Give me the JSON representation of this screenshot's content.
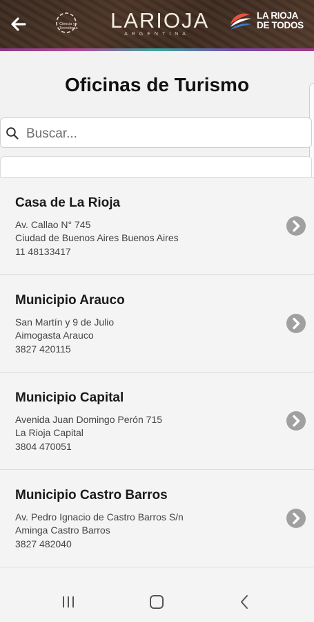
{
  "header": {
    "brand_title": "LARIOJA",
    "brand_subtitle": "ARGENTINA",
    "sub_logo_text": "Ciencia y Tecnología",
    "badge_line1": "LA RIOJA",
    "badge_line2": "DE TODOS"
  },
  "page": {
    "title": "Oficinas de Turismo"
  },
  "search": {
    "placeholder": "Buscar..."
  },
  "offices": [
    {
      "name": "Casa de La Rioja",
      "address": "Av. Callao N° 745",
      "city": "Ciudad de Buenos Aires Buenos Aires",
      "phone": "11 48133417"
    },
    {
      "name": "Municipio Arauco",
      "address": "San Martín y 9 de Julio",
      "city": "Aimogasta Arauco",
      "phone": "3827 420115"
    },
    {
      "name": "Municipio Capital",
      "address": "Avenida Juan Domingo Perón 715",
      "city": "La Rioja Capital",
      "phone": "3804 470051"
    },
    {
      "name": "Municipio Castro Barros",
      "address": "Av. Pedro Ignacio de Castro Barros S/n",
      "city": "Aminga Castro Barros",
      "phone": "3827 482040"
    }
  ],
  "icons": {
    "back": "arrow-left-icon",
    "search": "search-icon",
    "chevron": "chevron-right-icon",
    "nav_recents": "recents-icon",
    "nav_home": "home-icon",
    "nav_back": "nav-back-icon"
  },
  "colors": {
    "header_bg": "#3e2b20",
    "chevron_bg": "#a0a0a0",
    "accent_stripe": "#b24a9c"
  }
}
